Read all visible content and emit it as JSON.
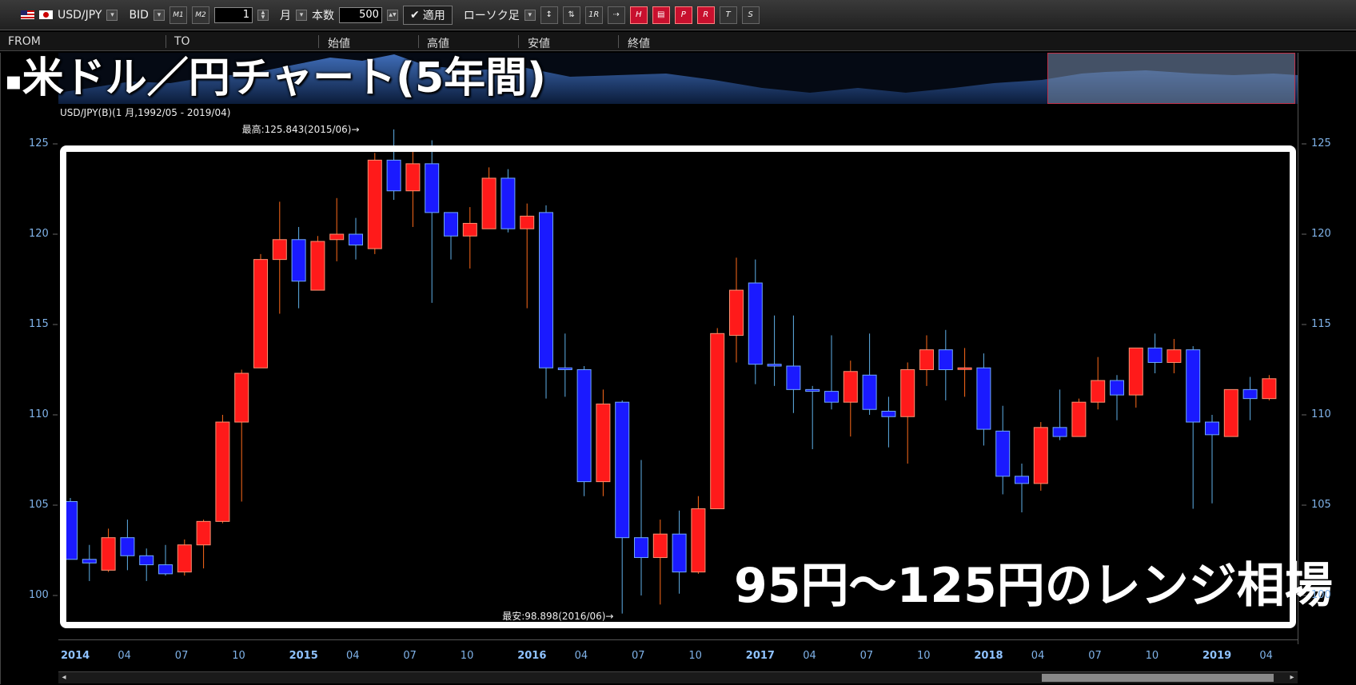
{
  "toolbar": {
    "pair": "USD/JPY",
    "side": "BID",
    "m1_label": "M1",
    "m2_label": "M2",
    "period_value": "1",
    "period_unit": "月",
    "count_label": "本数",
    "count_value": "500",
    "apply_label": "適用",
    "chart_type": "ローソク足",
    "tool_icons": [
      "tool-icon-1",
      "tool-icon-2",
      "tool-icon-1r",
      "tool-icon-line",
      "tool-icon-hl",
      "tool-icon-bar",
      "tool-icon-pb",
      "tool-icon-rb",
      "tool-icon-t",
      "tool-icon-sr"
    ]
  },
  "columns": [
    "FROM",
    "TO",
    "始値",
    "高値",
    "安値",
    "終値"
  ],
  "banner": {
    "bullet": "▪",
    "text_a": "米ドル／円チャート(",
    "text_b": "5",
    "text_c": "年間)"
  },
  "chart_subtitle": "USD/JPY(B)(1 月,1992/05 - 2019/04)",
  "annotations": {
    "high": "最高:125.843(2015/06)→",
    "low": "最安:98.898(2016/06)→"
  },
  "range_label": "95円～125円のレンジ相場",
  "colors": {
    "up": "#ff1a1a",
    "down": "#1a1aff",
    "wick_up": "#ff6a1a",
    "wick_down": "#5fb0e8",
    "axis": "#7fb2e8"
  },
  "chart_data": {
    "type": "candlestick",
    "ylim": [
      99,
      126
    ],
    "y_ticks": [
      "100",
      "105",
      "110",
      "115",
      "120",
      "125"
    ],
    "x_ticks": [
      "2014",
      "04",
      "07",
      "10",
      "2015",
      "04",
      "07",
      "10",
      "2016",
      "04",
      "07",
      "10",
      "2017",
      "04",
      "07",
      "10",
      "2018",
      "04",
      "07",
      "10",
      "2019",
      "04"
    ],
    "candles": [
      {
        "o": 105.2,
        "h": 105.4,
        "l": 102.0,
        "c": 102.0
      },
      {
        "o": 102.0,
        "h": 102.8,
        "l": 100.8,
        "c": 101.8
      },
      {
        "o": 101.4,
        "h": 103.7,
        "l": 101.3,
        "c": 103.2
      },
      {
        "o": 103.2,
        "h": 104.2,
        "l": 101.4,
        "c": 102.2
      },
      {
        "o": 102.2,
        "h": 102.6,
        "l": 100.8,
        "c": 101.7
      },
      {
        "o": 101.7,
        "h": 102.8,
        "l": 101.1,
        "c": 101.2
      },
      {
        "o": 101.3,
        "h": 103.1,
        "l": 101.1,
        "c": 102.8
      },
      {
        "o": 102.8,
        "h": 104.2,
        "l": 101.5,
        "c": 104.1
      },
      {
        "o": 104.1,
        "h": 110.0,
        "l": 104.0,
        "c": 109.6
      },
      {
        "o": 109.6,
        "h": 112.5,
        "l": 105.2,
        "c": 112.3
      },
      {
        "o": 112.6,
        "h": 118.9,
        "l": 112.6,
        "c": 118.6
      },
      {
        "o": 118.6,
        "h": 121.8,
        "l": 115.6,
        "c": 119.7
      },
      {
        "o": 119.7,
        "h": 120.4,
        "l": 115.9,
        "c": 117.4
      },
      {
        "o": 116.9,
        "h": 119.9,
        "l": 116.9,
        "c": 119.6
      },
      {
        "o": 119.7,
        "h": 122.0,
        "l": 118.5,
        "c": 120.0
      },
      {
        "o": 120.0,
        "h": 120.9,
        "l": 118.6,
        "c": 119.4
      },
      {
        "o": 119.2,
        "h": 124.5,
        "l": 118.9,
        "c": 124.1
      },
      {
        "o": 124.1,
        "h": 125.8,
        "l": 121.9,
        "c": 122.4
      },
      {
        "o": 122.4,
        "h": 124.6,
        "l": 120.4,
        "c": 123.9
      },
      {
        "o": 123.9,
        "h": 125.2,
        "l": 116.2,
        "c": 121.2
      },
      {
        "o": 121.2,
        "h": 121.2,
        "l": 118.6,
        "c": 119.9
      },
      {
        "o": 119.9,
        "h": 121.5,
        "l": 118.1,
        "c": 120.6
      },
      {
        "o": 120.3,
        "h": 123.7,
        "l": 120.3,
        "c": 123.1
      },
      {
        "o": 123.1,
        "h": 123.6,
        "l": 120.1,
        "c": 120.3
      },
      {
        "o": 120.3,
        "h": 121.7,
        "l": 115.9,
        "c": 121.0
      },
      {
        "o": 121.2,
        "h": 121.6,
        "l": 110.9,
        "c": 112.6
      },
      {
        "o": 112.6,
        "h": 114.5,
        "l": 111.0,
        "c": 112.5
      },
      {
        "o": 112.5,
        "h": 112.7,
        "l": 105.5,
        "c": 106.3
      },
      {
        "o": 106.3,
        "h": 111.4,
        "l": 105.5,
        "c": 110.6
      },
      {
        "o": 110.7,
        "h": 110.8,
        "l": 99.0,
        "c": 103.2
      },
      {
        "o": 103.2,
        "h": 107.5,
        "l": 100.0,
        "c": 102.1
      },
      {
        "o": 102.1,
        "h": 104.2,
        "l": 99.5,
        "c": 103.4
      },
      {
        "o": 103.4,
        "h": 104.7,
        "l": 100.1,
        "c": 101.3
      },
      {
        "o": 101.3,
        "h": 105.5,
        "l": 101.2,
        "c": 104.8
      },
      {
        "o": 104.8,
        "h": 114.8,
        "l": 104.8,
        "c": 114.5
      },
      {
        "o": 114.4,
        "h": 118.7,
        "l": 112.9,
        "c": 116.9
      },
      {
        "o": 117.3,
        "h": 118.6,
        "l": 111.7,
        "c": 112.8
      },
      {
        "o": 112.8,
        "h": 115.5,
        "l": 111.6,
        "c": 112.7
      },
      {
        "o": 112.7,
        "h": 115.5,
        "l": 110.1,
        "c": 111.4
      },
      {
        "o": 111.4,
        "h": 111.6,
        "l": 108.1,
        "c": 111.3
      },
      {
        "o": 111.3,
        "h": 114.4,
        "l": 110.3,
        "c": 110.7
      },
      {
        "o": 110.7,
        "h": 113.0,
        "l": 108.8,
        "c": 112.4
      },
      {
        "o": 112.2,
        "h": 114.5,
        "l": 110.0,
        "c": 110.3
      },
      {
        "o": 110.2,
        "h": 111.0,
        "l": 108.2,
        "c": 109.9
      },
      {
        "o": 109.9,
        "h": 112.9,
        "l": 107.3,
        "c": 112.5
      },
      {
        "o": 112.5,
        "h": 114.4,
        "l": 111.6,
        "c": 113.6
      },
      {
        "o": 113.6,
        "h": 114.7,
        "l": 110.8,
        "c": 112.5
      },
      {
        "o": 112.6,
        "h": 113.7,
        "l": 111.0,
        "c": 112.6
      },
      {
        "o": 112.6,
        "h": 113.4,
        "l": 108.3,
        "c": 109.2
      },
      {
        "o": 109.1,
        "h": 110.5,
        "l": 105.6,
        "c": 106.6
      },
      {
        "o": 106.6,
        "h": 107.3,
        "l": 104.6,
        "c": 106.2
      },
      {
        "o": 106.2,
        "h": 109.6,
        "l": 105.8,
        "c": 109.3
      },
      {
        "o": 109.3,
        "h": 111.4,
        "l": 108.6,
        "c": 108.8
      },
      {
        "o": 108.8,
        "h": 110.9,
        "l": 108.8,
        "c": 110.7
      },
      {
        "o": 110.7,
        "h": 113.2,
        "l": 110.3,
        "c": 111.9
      },
      {
        "o": 111.9,
        "h": 112.2,
        "l": 109.7,
        "c": 111.1
      },
      {
        "o": 111.1,
        "h": 113.7,
        "l": 110.4,
        "c": 113.7
      },
      {
        "o": 113.7,
        "h": 114.5,
        "l": 112.3,
        "c": 112.9
      },
      {
        "o": 112.9,
        "h": 114.2,
        "l": 112.3,
        "c": 113.6
      },
      {
        "o": 113.6,
        "h": 113.8,
        "l": 104.8,
        "c": 109.6
      },
      {
        "o": 109.6,
        "h": 110.0,
        "l": 105.1,
        "c": 108.9
      },
      {
        "o": 108.8,
        "h": 111.4,
        "l": 108.8,
        "c": 111.4
      },
      {
        "o": 111.4,
        "h": 112.1,
        "l": 109.7,
        "c": 110.9
      },
      {
        "o": 110.9,
        "h": 112.2,
        "l": 110.8,
        "c": 112.0
      }
    ]
  }
}
